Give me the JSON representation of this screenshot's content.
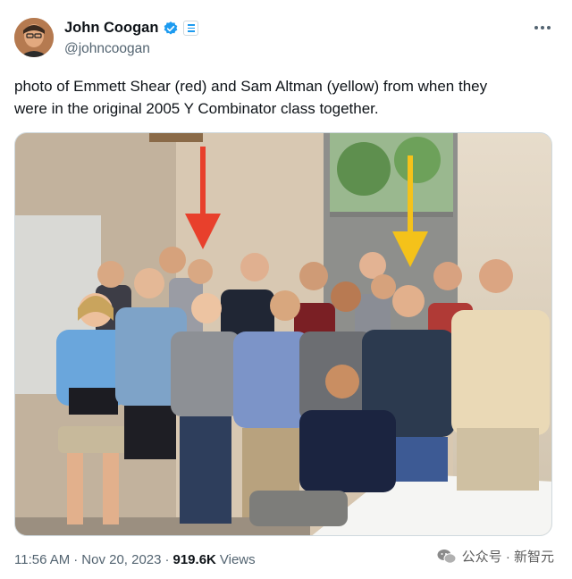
{
  "author": {
    "display_name": "John Coogan",
    "handle": "@johncoogan"
  },
  "tweet": {
    "text_line1": "photo of Emmett Shear (red) and Sam Altman (yellow) from when they",
    "text_line2": "were in the original 2005 Y Combinator class together."
  },
  "footer": {
    "time": "11:56 AM",
    "separator": "·",
    "date": "Nov 20, 2023",
    "views_count": "919.6K",
    "views_label": "Views"
  },
  "watermark": {
    "label": "公众号 · 新智元"
  },
  "colors": {
    "verified": "#1d9bf0",
    "red_arrow": "#e8402c",
    "yellow_arrow": "#f4c21a"
  },
  "icons": [
    "verified-badge-icon",
    "affiliate-badge-icon",
    "more-options-icon",
    "wechat-icon"
  ]
}
